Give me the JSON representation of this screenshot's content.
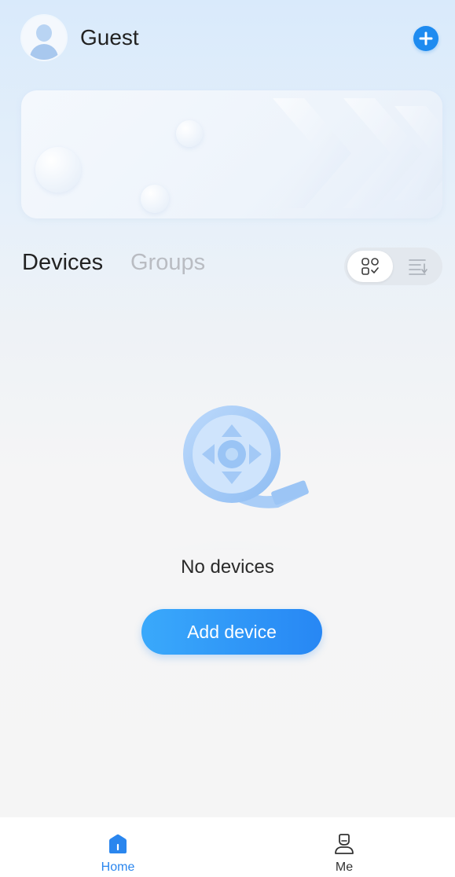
{
  "header": {
    "username": "Guest",
    "add_icon": "plus-circle-icon"
  },
  "section": {
    "tabs": [
      {
        "label": "Devices",
        "active": true
      },
      {
        "label": "Groups",
        "active": false
      }
    ],
    "view_toggle": {
      "grid_icon": "grid-view-icon",
      "list_icon": "list-view-icon",
      "selected": "grid"
    }
  },
  "empty_state": {
    "message": "No devices",
    "button_label": "Add device",
    "illustration_icon": "film-reel-icon"
  },
  "bottom_nav": {
    "items": [
      {
        "label": "Home",
        "icon": "home-icon",
        "active": true
      },
      {
        "label": "Me",
        "icon": "user-icon",
        "active": false
      }
    ]
  },
  "colors": {
    "accent": "#2787f4",
    "active_nav": "#2a86ee",
    "inactive_tab": "#b9bcc2"
  }
}
